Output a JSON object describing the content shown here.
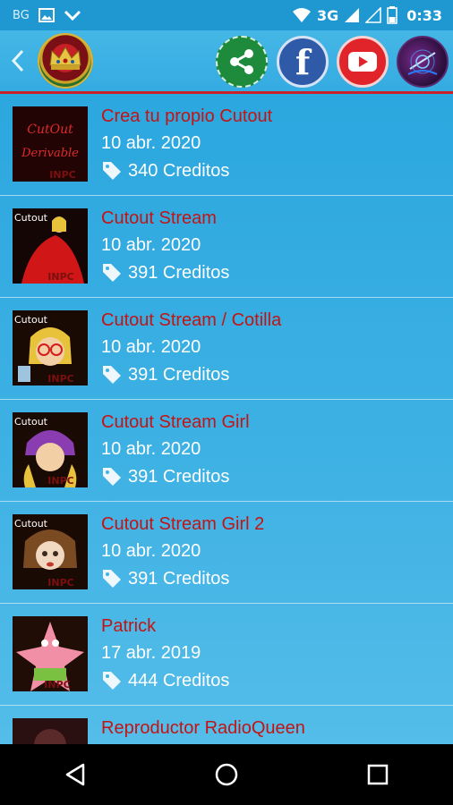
{
  "status_bar": {
    "carrier": "BG",
    "network": "3G",
    "time": "0:33"
  },
  "header": {
    "icons": [
      "back-icon",
      "crown-logo",
      "share-icon",
      "facebook-icon",
      "youtube-icon",
      "radio-icon"
    ],
    "facebook_glyph": "f"
  },
  "thumbs": [
    {
      "top": "CutOut",
      "bottom": "Derivable",
      "mark": "INPC"
    },
    {
      "tag": "Cutout",
      "mark": "INPC"
    },
    {
      "tag": "Cutout",
      "mark": "INPC"
    },
    {
      "tag": "Cutout",
      "mark": "INPC"
    },
    {
      "tag": "Cutout",
      "mark": "INPC"
    },
    {
      "mark": "INPC"
    }
  ],
  "items": [
    {
      "title": "Crea tu propio Cutout",
      "date": "10 abr. 2020",
      "credits": "340 Creditos"
    },
    {
      "title": "Cutout Stream",
      "date": "10 abr. 2020",
      "credits": "391 Creditos"
    },
    {
      "title": "Cutout Stream / Cotilla",
      "date": "10 abr. 2020",
      "credits": "391 Creditos"
    },
    {
      "title": "Cutout Stream Girl",
      "date": "10 abr. 2020",
      "credits": "391 Creditos"
    },
    {
      "title": "Cutout Stream Girl 2",
      "date": "10 abr. 2020",
      "credits": "391 Creditos"
    },
    {
      "title": "Patrick",
      "date": "17 abr. 2019",
      "credits": "444 Creditos"
    },
    {
      "title": "Reproductor RadioQueen",
      "date": "",
      "credits": ""
    }
  ],
  "nav_bar": {
    "icons": [
      "back-triangle-icon",
      "home-circle-icon",
      "recents-square-icon"
    ]
  },
  "colors": {
    "title_red": "#c31414",
    "accent_line": "#c9202a",
    "list_bg": "#29a6de"
  }
}
